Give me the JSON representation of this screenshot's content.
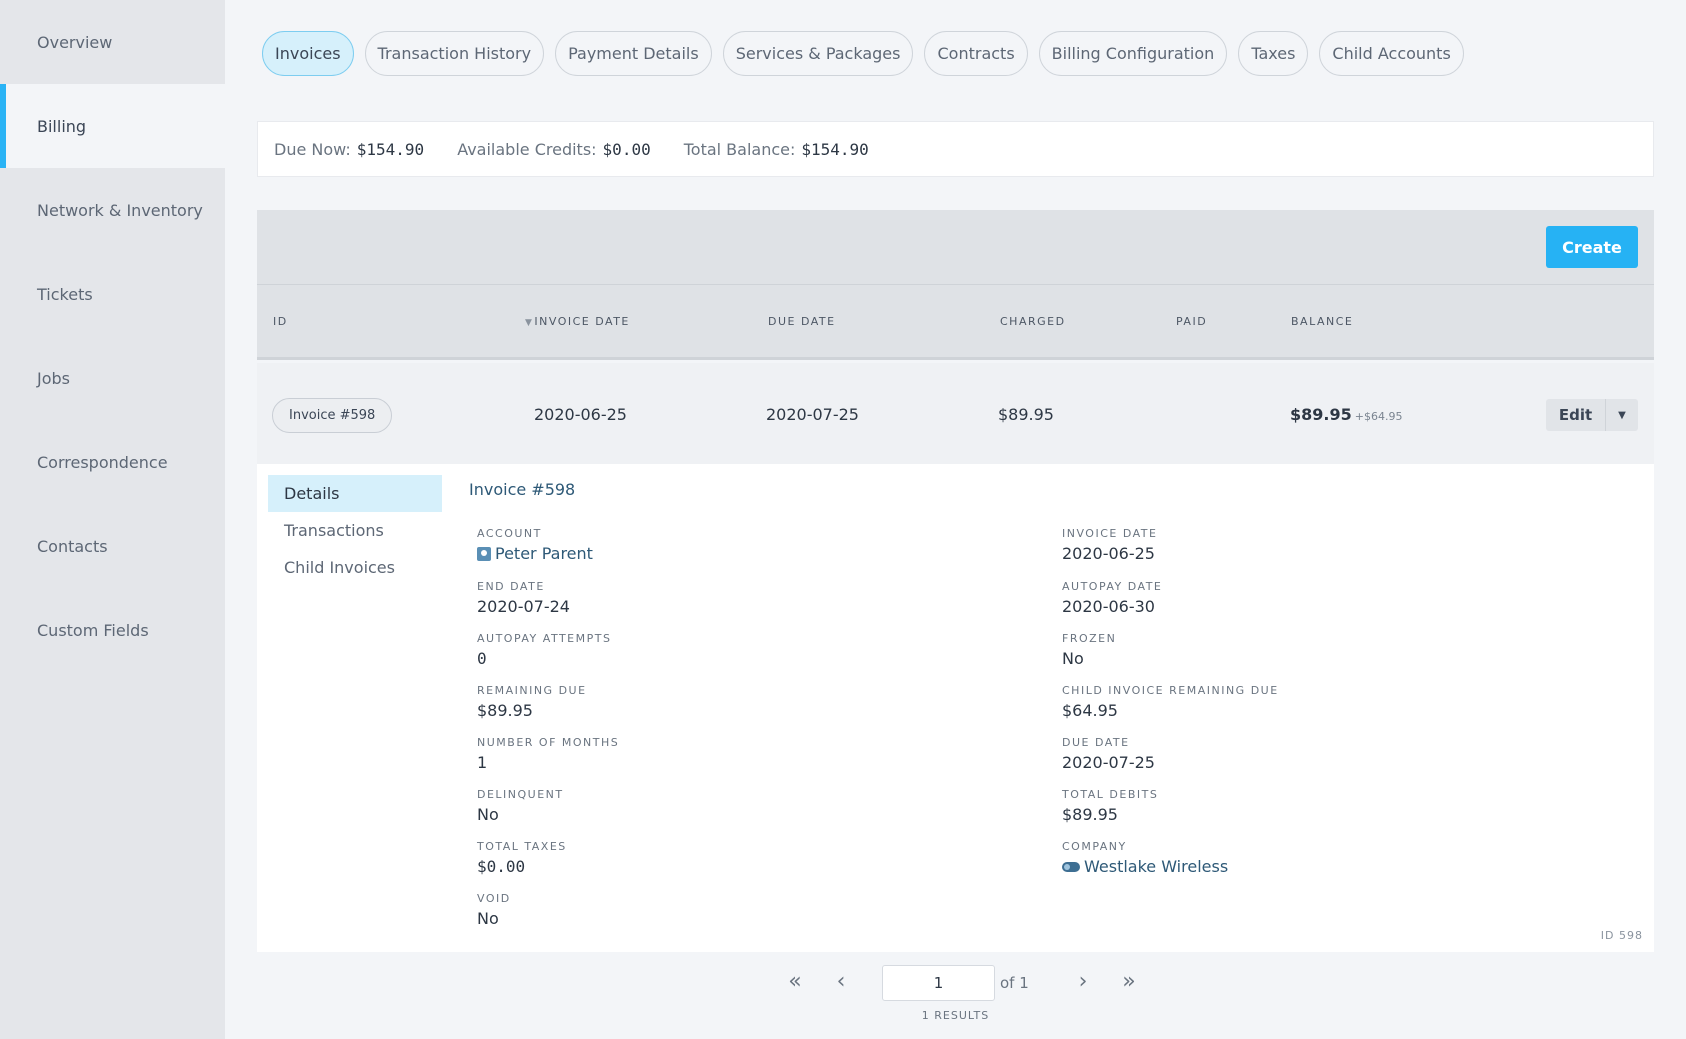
{
  "sidebar": {
    "items": [
      {
        "label": "Overview"
      },
      {
        "label": "Billing"
      },
      {
        "label": "Network & Inventory"
      },
      {
        "label": "Tickets"
      },
      {
        "label": "Jobs"
      },
      {
        "label": "Correspondence"
      },
      {
        "label": "Contacts"
      },
      {
        "label": "Custom Fields"
      }
    ],
    "active": "Billing"
  },
  "tabs": [
    "Invoices",
    "Transaction History",
    "Payment Details",
    "Services & Packages",
    "Contracts",
    "Billing Configuration",
    "Taxes",
    "Child Accounts"
  ],
  "summary": {
    "due_now_label": "Due Now:",
    "due_now": "$154.90",
    "credits_label": "Available Credits:",
    "credits": "$0.00",
    "balance_label": "Total Balance:",
    "balance": "$154.90"
  },
  "toolbar": {
    "create_label": "Create"
  },
  "table": {
    "headers": {
      "id": "ID",
      "invoice_date": "INVOICE DATE",
      "due_date": "DUE DATE",
      "charged": "CHARGED",
      "paid": "PAID",
      "balance": "BALANCE"
    },
    "row": {
      "id": "Invoice #598",
      "invoice_date": "2020-06-25",
      "due_date": "2020-07-25",
      "charged": "$89.95",
      "paid": "",
      "balance": "$89.95",
      "balance_extra": "+$64.95",
      "edit_label": "Edit"
    }
  },
  "detail": {
    "nav": [
      "Details",
      "Transactions",
      "Child Invoices"
    ],
    "title": "Invoice #598",
    "left": [
      {
        "label": "Account",
        "value": "Peter Parent"
      },
      {
        "label": "End Date",
        "value": "2020-07-24"
      },
      {
        "label": "Autopay Attempts",
        "value": "0"
      },
      {
        "label": "Remaining Due",
        "value": "$89.95"
      },
      {
        "label": "Number of Months",
        "value": "1"
      },
      {
        "label": "Delinquent",
        "value": "No"
      },
      {
        "label": "Total Taxes",
        "value": "$0.00"
      },
      {
        "label": "Void",
        "value": "No"
      }
    ],
    "right": [
      {
        "label": "Invoice Date",
        "value": "2020-06-25"
      },
      {
        "label": "Autopay Date",
        "value": "2020-06-30"
      },
      {
        "label": "Frozen",
        "value": "No"
      },
      {
        "label": "Child Invoice Remaining Due",
        "value": "$64.95"
      },
      {
        "label": "Due Date",
        "value": "2020-07-25"
      },
      {
        "label": "Total Debits",
        "value": "$89.95"
      },
      {
        "label": "Company",
        "value": "Westlake Wireless"
      }
    ],
    "id_footer": "ID 598"
  },
  "pagination": {
    "page": "1",
    "of_label": "of 1",
    "results": "1 RESULTS"
  },
  "icons": {
    "account": "account-icon",
    "company": "company-icon",
    "first": "«",
    "prev": "‹",
    "next": "›",
    "last": "»"
  },
  "colors": {
    "accent": "#26b2f4",
    "active_tab_bg": "#d6f0fb",
    "link": "#2e5977"
  }
}
